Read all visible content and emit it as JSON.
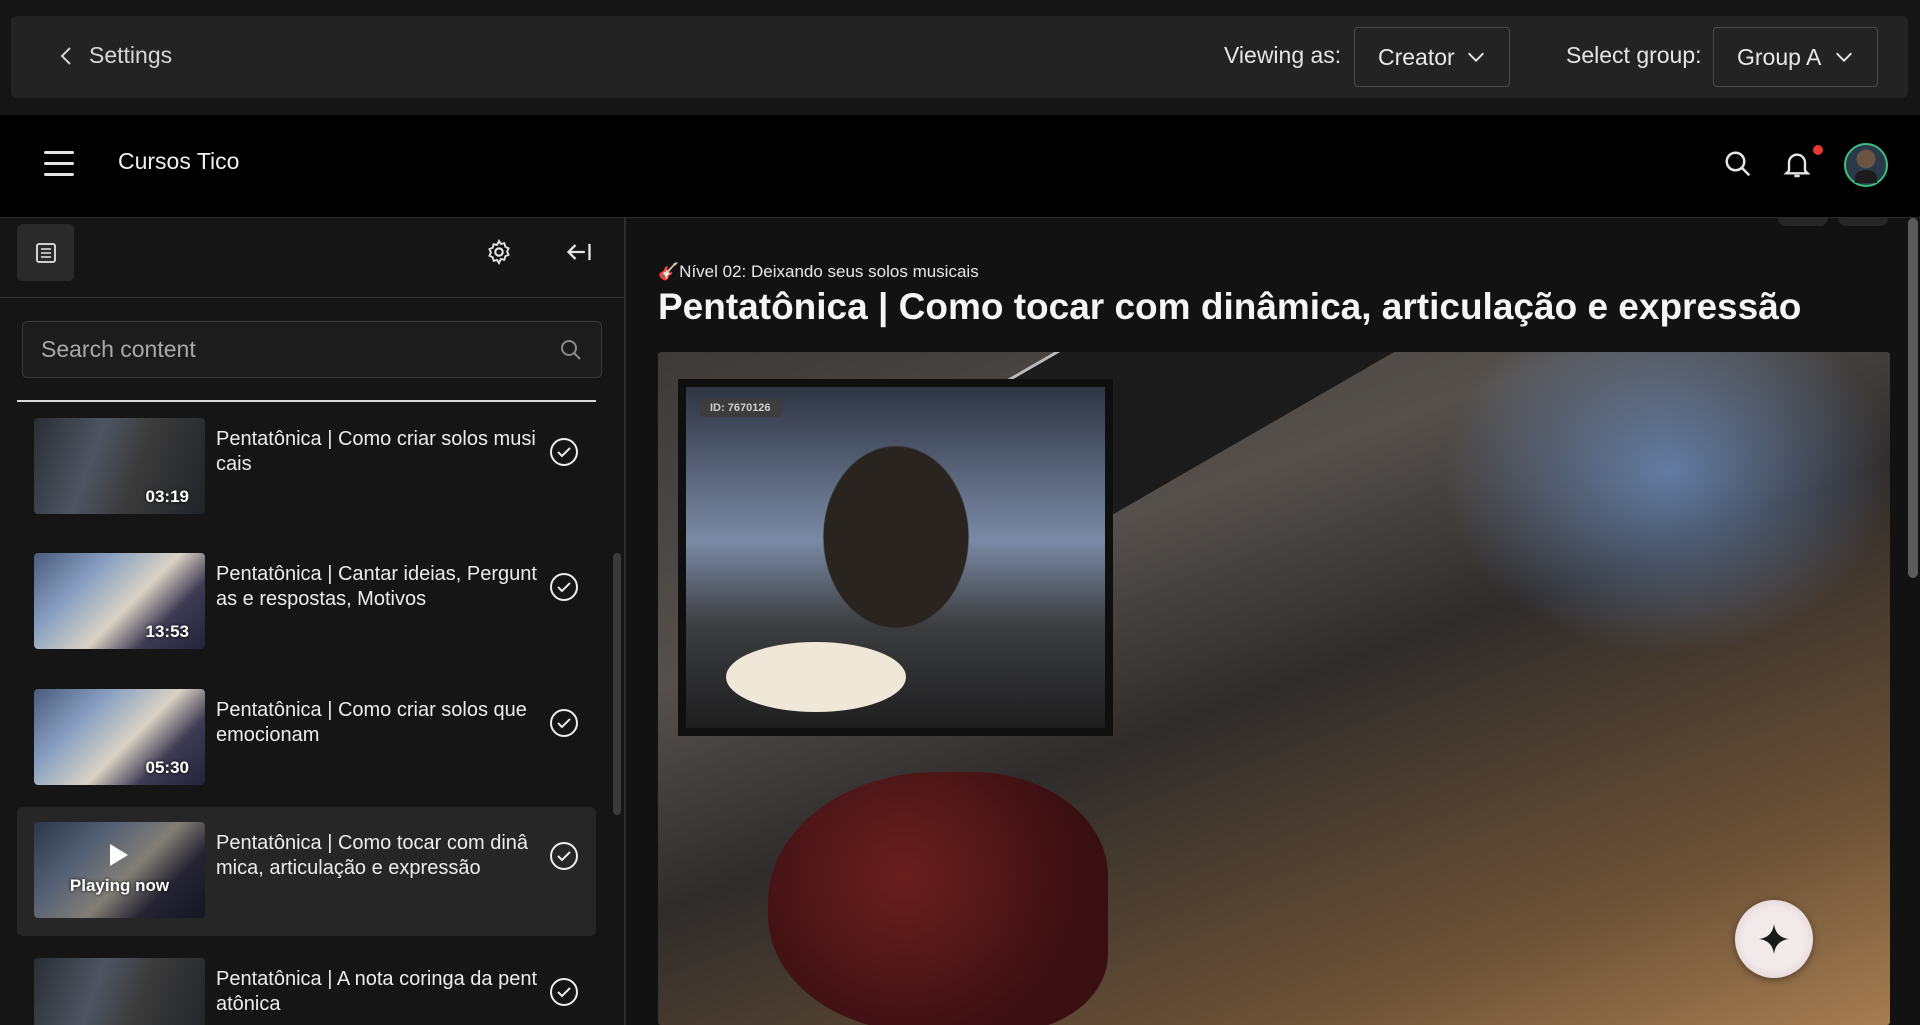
{
  "settings_bar": {
    "back_label": "Settings",
    "viewing_as_label": "Viewing as:",
    "viewing_as_value": "Creator",
    "select_group_label": "Select group:",
    "select_group_value": "Group A"
  },
  "app_header": {
    "title": "Cursos Tico",
    "notification_dot_color": "#e53935"
  },
  "sidebar": {
    "search_placeholder": "Search content",
    "lessons": [
      {
        "title": "Pentatônica | Como criar solos musicais",
        "duration": "03:19",
        "completed": true,
        "active": false
      },
      {
        "title": "Pentatônica | Cantar ideias, Perguntas e respostas, Motivos",
        "duration": "13:53",
        "completed": true,
        "active": false
      },
      {
        "title": "Pentatônica | Como criar solos que emocionam",
        "duration": "05:30",
        "completed": true,
        "active": false
      },
      {
        "title": "Pentatônica | Como tocar com dinâmica, articulação e expressão",
        "duration": "",
        "status": "Playing now",
        "completed": true,
        "active": true
      },
      {
        "title": "Pentatônica | A nota coringa da pentatônica",
        "duration": "",
        "completed": true,
        "active": false
      }
    ]
  },
  "main": {
    "breadcrumb": "🎸Nível 02: Deixando seus solos musicais",
    "title": "Pentatônica | Como tocar com dinâmica, articulação e expressão",
    "video_overlay_id": "ID: 7670126"
  }
}
